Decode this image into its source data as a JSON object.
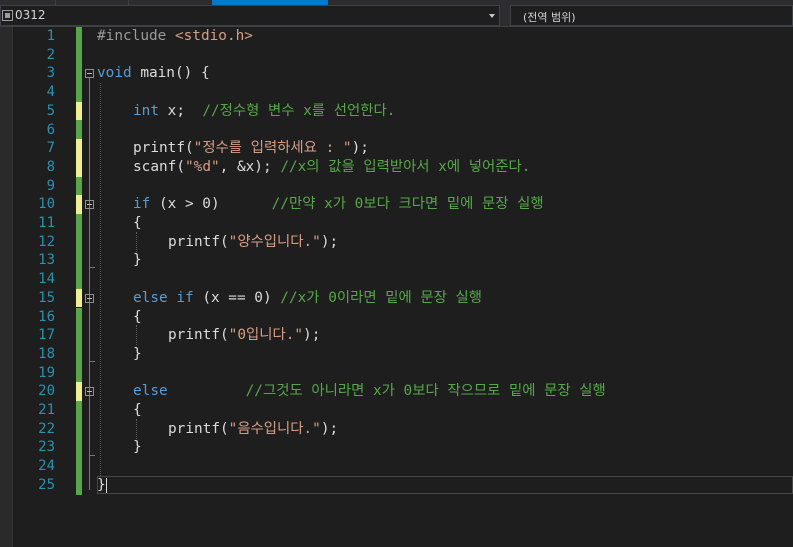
{
  "navbar": {
    "project_label": "0312",
    "scope_label": "(전역 범위)"
  },
  "lines": [
    {
      "n": "1"
    },
    {
      "n": "2"
    },
    {
      "n": "3"
    },
    {
      "n": "4"
    },
    {
      "n": "5"
    },
    {
      "n": "6"
    },
    {
      "n": "7"
    },
    {
      "n": "8"
    },
    {
      "n": "9"
    },
    {
      "n": "10"
    },
    {
      "n": "11"
    },
    {
      "n": "12"
    },
    {
      "n": "13"
    },
    {
      "n": "14"
    },
    {
      "n": "15"
    },
    {
      "n": "16"
    },
    {
      "n": "17"
    },
    {
      "n": "18"
    },
    {
      "n": "19"
    },
    {
      "n": "20"
    },
    {
      "n": "21"
    },
    {
      "n": "22"
    },
    {
      "n": "23"
    },
    {
      "n": "24"
    },
    {
      "n": "25"
    }
  ],
  "code": {
    "l1_pp": "#include",
    "l1_inc": "<stdio.h>",
    "l3_kw": "void",
    "l3_rest": " main() {",
    "l5_kw": "int",
    "l5_rest": " x;  ",
    "l5_cm": "//정수형 변수 x를 선언한다.",
    "l7_fn": "printf(",
    "l7_str": "\"정수를 입력하세요 : \"",
    "l7_end": ");",
    "l8_fn": "scanf(",
    "l8_str1": "\"",
    "l8_fmt": "%d",
    "l8_str2": "\"",
    "l8_rest": ", &x); ",
    "l8_cm": "//x의 값을 입력받아서 x에 넣어준다.",
    "l10_kw": "if",
    "l10_rest": " (x > 0)      ",
    "l10_cm": "//만약 x가 0보다 크다면 밑에 문장 실행",
    "l11": "{",
    "l12_fn": "printf(",
    "l12_str": "\"양수입니다.\"",
    "l12_end": ");",
    "l13": "}",
    "l15_kw1": "else",
    "l15_kw2": "if",
    "l15_rest": " (x == 0) ",
    "l15_cm": "//x가 0이라면 밑에 문장 실행",
    "l16": "{",
    "l17_fn": "printf(",
    "l17_str": "\"0입니다.\"",
    "l17_end": ");",
    "l18": "}",
    "l20_kw": "else",
    "l20_cm": "//그것도 아니라면 x가 0보다 작으므로 밑에 문장 실행",
    "l21": "{",
    "l22_fn": "printf(",
    "l22_str": "\"음수입니다.\"",
    "l22_end": ");",
    "l23": "}",
    "l25": "}"
  },
  "colors": {
    "background": "#1e1e1e",
    "keyword": "#569cd6",
    "string": "#d69d85",
    "comment": "#57a64a",
    "line_number": "#2b91af",
    "change_saved": "#57a64a",
    "change_unsaved": "#efef91"
  }
}
